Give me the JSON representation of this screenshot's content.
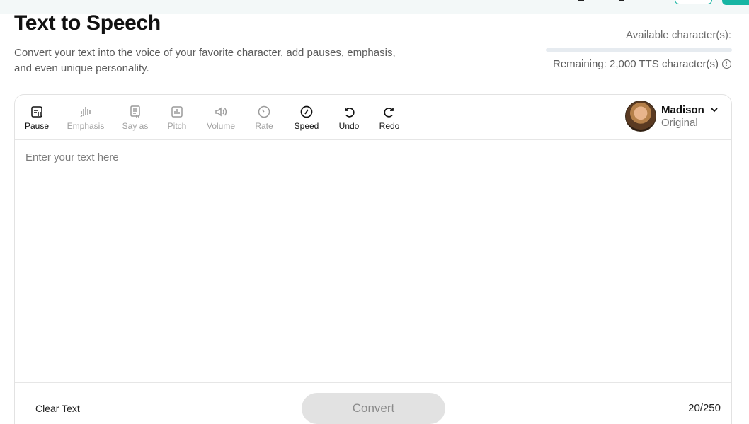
{
  "page": {
    "title": "Text to Speech",
    "description": "Convert your text into the voice of your favorite character, add pauses, emphasis, and even unique personality."
  },
  "usage": {
    "available_label": "Available character(s):",
    "remaining_text": "Remaining: 2,000 TTS character(s)",
    "available_fraction": 0
  },
  "toolbar": {
    "tools": [
      {
        "label": "Pause",
        "icon": "pause-icon",
        "enabled": true
      },
      {
        "label": "Emphasis",
        "icon": "emphasis-icon",
        "enabled": false
      },
      {
        "label": "Say as",
        "icon": "say-as-icon",
        "enabled": false
      },
      {
        "label": "Pitch",
        "icon": "pitch-icon",
        "enabled": false
      },
      {
        "label": "Volume",
        "icon": "volume-icon",
        "enabled": false
      },
      {
        "label": "Rate",
        "icon": "rate-icon",
        "enabled": false
      },
      {
        "label": "Speed",
        "icon": "speed-icon",
        "enabled": true
      },
      {
        "label": "Undo",
        "icon": "undo-icon",
        "enabled": true
      },
      {
        "label": "Redo",
        "icon": "redo-icon",
        "enabled": true
      }
    ]
  },
  "voice": {
    "name": "Madison",
    "style": "Original"
  },
  "editor": {
    "placeholder": "Enter your text here",
    "value": ""
  },
  "footer": {
    "clear_label": "Clear Text",
    "convert_label": "Convert",
    "count": "20/250"
  },
  "colors": {
    "accent": "#17b5a3",
    "disabled": "#a0a0a0"
  }
}
